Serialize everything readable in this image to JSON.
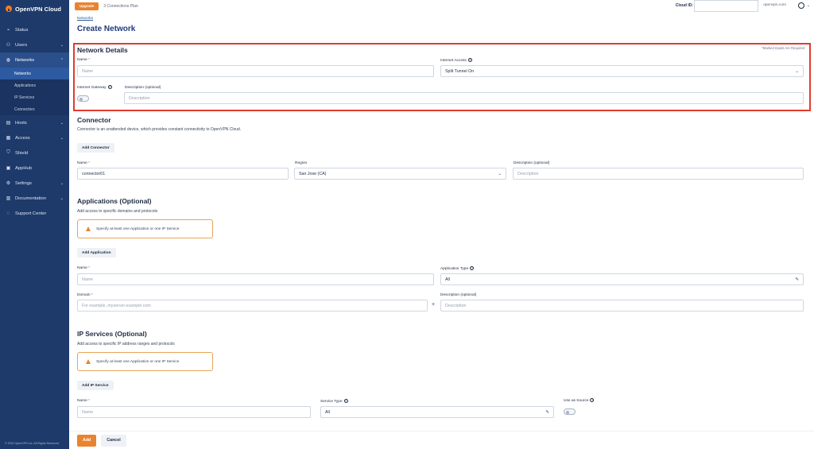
{
  "app": {
    "name": "OpenVPN Cloud",
    "copyright": "© 2022 OpenVPN Inc. All Rights Reserved"
  },
  "sidebar": {
    "items": [
      {
        "label": "Status",
        "icon": "chart-icon"
      },
      {
        "label": "Users",
        "icon": "users-icon"
      },
      {
        "label": "Networks",
        "icon": "globe-icon"
      },
      {
        "label": "Hosts",
        "icon": "server-icon"
      },
      {
        "label": "Access",
        "icon": "grid-icon"
      },
      {
        "label": "Shield",
        "icon": "shield-icon"
      },
      {
        "label": "AppHub",
        "icon": "apps-icon"
      },
      {
        "label": "Settings",
        "icon": "gear-icon"
      },
      {
        "label": "Documentation",
        "icon": "book-icon"
      },
      {
        "label": "Support Center",
        "icon": "chat-icon"
      }
    ],
    "networks_sub": [
      "Networks",
      "Applications",
      "IP Services",
      "Connectors"
    ]
  },
  "topbar": {
    "upgrade": "Upgrade",
    "plan": "3 Connections Plan",
    "cloud_id_label": "Cloud ID:",
    "domain": "openvpn.com"
  },
  "page": {
    "breadcrumb": "Networks",
    "title": "Create Network",
    "required_note": "Marked Inputs Are Required"
  },
  "network_details": {
    "title": "Network Details",
    "name_label": "Name",
    "name_placeholder": "Name",
    "internet_access_label": "Internet Access",
    "internet_access_value": "Split Tunnel On",
    "gateway_label": "Internet Gateway",
    "description_label": "Description (optional)",
    "description_placeholder": "Description"
  },
  "connector": {
    "title": "Connector",
    "desc": "Connector is an unattended device, which provides constant connectivity to OpenVPN Cloud.",
    "add_button": "Add Connector",
    "name_label": "Name",
    "name_value": "connector01",
    "region_label": "Region",
    "region_value": "San Jose (CA)",
    "description_label": "Description (optional)",
    "description_placeholder": "Description"
  },
  "applications": {
    "title": "Applications (Optional)",
    "desc": "Add access to specific domains and protocols",
    "warning": "Specify at least one Application or one IP Service",
    "add_button": "Add Application",
    "name_label": "Name",
    "name_placeholder": "Name",
    "type_label": "Application Type",
    "type_value": "All",
    "domain_label": "Domain",
    "domain_placeholder": "For example, myserver.example.com",
    "description_label": "Description (optional)",
    "description_placeholder": "Description"
  },
  "ip_services": {
    "title": "IP Services (Optional)",
    "desc": "Add access to specific IP address ranges and protocols",
    "warning": "Specify at least one Application or one IP Service",
    "add_button": "Add IP Service",
    "name_label": "Name",
    "name_placeholder": "Name",
    "type_label": "Service Type",
    "type_value": "All",
    "source_label": "Use as Source"
  },
  "footer": {
    "add": "Add",
    "cancel": "Cancel"
  },
  "colors": {
    "sidebar": "#1e3a6a",
    "accent": "#e8832f",
    "highlight": "#e23b2e"
  }
}
